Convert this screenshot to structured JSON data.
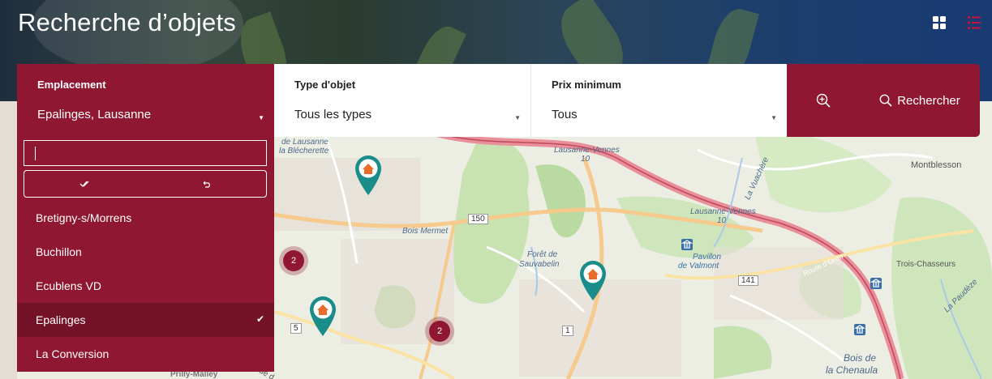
{
  "page": {
    "title": "Recherche d’objets"
  },
  "view_toggle": {
    "grid_icon": "grid-icon",
    "list_icon": "list-icon",
    "active_color": "#c0163c"
  },
  "search": {
    "location": {
      "label": "Emplacement",
      "value": "Epalinges, Lausanne"
    },
    "type": {
      "label": "Type d'objet",
      "value": "Tous les types"
    },
    "price": {
      "label": "Prix minimum",
      "value": "Tous"
    },
    "map_button_icon": "zoom-in-icon",
    "search_button": {
      "label": "Rechercher",
      "icon": "search-icon"
    }
  },
  "dropdown": {
    "search_value": "",
    "items": [
      {
        "label": "Bretigny-s/Morrens",
        "selected": false
      },
      {
        "label": "Buchillon",
        "selected": false
      },
      {
        "label": "Ecublens VD",
        "selected": false
      },
      {
        "label": "Epalinges",
        "selected": true
      },
      {
        "label": "La Conversion",
        "selected": false
      }
    ]
  },
  "map": {
    "labels": {
      "ecole": "de Lausanne",
      "blecherette": "la Blécherette",
      "lausanne_vennes_1": "Lausanne-Vennes",
      "vennes_1_num": "10",
      "vennes_2": "Lausanne-Vennes",
      "vennes_2_num": "10",
      "montblesson": "Montblesson",
      "bois_mermet": "Bois Mermet",
      "foret_1": "Forêt de",
      "foret_2": "Sauvabelin",
      "pavillon_1": "Pavillon",
      "pavillon_2": "de Valmont",
      "route_oron": "Route d'Oron",
      "trois_chasseurs": "Trois-Chasseurs",
      "paudeze": "La Paudèze",
      "bois_1": "Bois de",
      "bois_2": "la Chenaula",
      "prilly": "Prilly-Malley",
      "la_vuachere": "La Vuachère",
      "rue": "Rue d"
    },
    "shields": {
      "r150": "150",
      "r141": "141",
      "r5": "5",
      "r1": "1"
    },
    "clusters": [
      "2",
      "2"
    ],
    "marker_color": "#1a8d8b"
  }
}
